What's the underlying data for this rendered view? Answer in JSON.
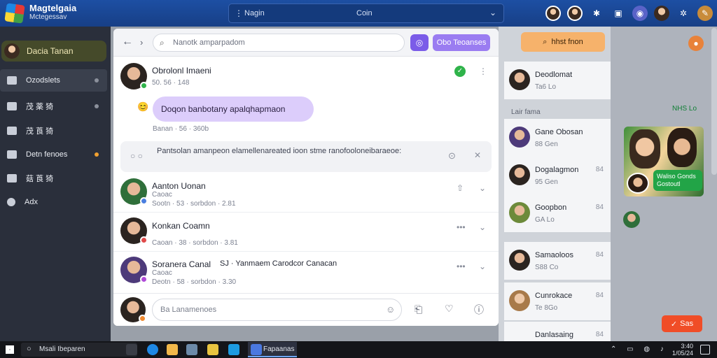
{
  "app": {
    "title": "Magtelgaia",
    "subtitle": "Mctegessav"
  },
  "topbar": {
    "search_label": "Nagin",
    "search_mid": "Coin"
  },
  "sidebar": {
    "user": "Dacia Tanan",
    "items": [
      {
        "label": "Ozodslets"
      },
      {
        "label": "茂 薬 猗"
      },
      {
        "label": "茂 莨 猗"
      },
      {
        "label": "Detn fenoes"
      },
      {
        "label": "菇 莨 猗"
      },
      {
        "label": "Adx"
      }
    ]
  },
  "main": {
    "search_placeholder": "Nanotk amparpadom",
    "btn2_label": "Obo Teoanses",
    "top_person": {
      "name": "Obrolonl Imaeni",
      "meta": "50. 56 · 148"
    },
    "bubble": "Doqon banbotany apalqhapmaon",
    "bubble_meta": "Banan · 56 · 360b",
    "notice": "Pantsolan amanpeon elamellenareated ioon stme ranofooloneibaraeoe:",
    "rows": [
      {
        "name": "Aanton Uonan",
        "sub": "Caoac",
        "meta": "Sootn · 53 · sorbdon · 2.81"
      },
      {
        "name": "Konkan Coamn",
        "sub": "",
        "meta": "Caoan · 38 · sorbdon · 3.81"
      },
      {
        "name": "Soranera Canal",
        "extra": "SJ · Yanmaem Carodcor Canacan",
        "sub": "Caoac",
        "meta": "Deotn · 58 · sorbdon · 3.30"
      }
    ],
    "composer_placeholder": "Ba Lanamenoes"
  },
  "right": {
    "find_button": "hhst fnon",
    "section_label": "Lair fama",
    "green_label": "NHS Lo",
    "items": [
      {
        "name": "Deodlomat",
        "sub": "Ta6 Lo",
        "count": ""
      },
      {
        "name": "Gane Obosan",
        "sub": "88 Gen",
        "count": ""
      },
      {
        "name": "Dogalagmon",
        "sub": "95 Gen",
        "count": "84"
      },
      {
        "name": "Goopbon",
        "sub": "GA Lo",
        "count": "84"
      },
      {
        "name": "Samaoloos",
        "sub": "S88 Co",
        "count": "84"
      },
      {
        "name": "Cunrokace",
        "sub": "Te 8Go",
        "count": "84"
      },
      {
        "name": "Danlasaing",
        "sub": "",
        "count": "84"
      }
    ],
    "photo_pill": "Waliso Gonds Gostoutl",
    "red_button": "Sas"
  },
  "taskbar": {
    "search": "Msali Ibeparen",
    "active_app": "Fapaanas",
    "clock_time": "3:40",
    "clock_date": "1/05/24"
  },
  "colors": {
    "accent": "#7b5ce8",
    "topbar": "#1d4fa3",
    "sidebar": "#2a2f3b",
    "orange": "#f6b26b",
    "green": "#22a447"
  }
}
